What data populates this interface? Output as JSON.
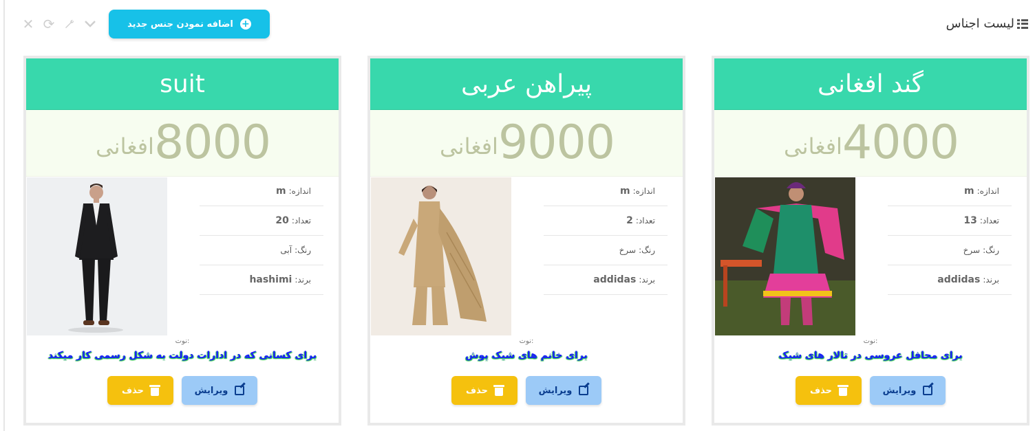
{
  "header": {
    "title": "لیست اجناس",
    "add_button_label": "اضافه نمودن جنس جدید"
  },
  "toolbar_icons": [
    "close-icon",
    "refresh-icon",
    "wrench-icon",
    "chevron-down-icon"
  ],
  "labels": {
    "size": "اندازه:",
    "count": "تعداد:",
    "color": "رنگ:",
    "brand": "برند:",
    "note": "نوت:",
    "currency": "افغانی",
    "edit": "ویرایش",
    "delete": "حذف"
  },
  "products": [
    {
      "name": "suit",
      "price": "8000",
      "size": "m",
      "count": "20",
      "color": "آبی",
      "brand": "hashimi",
      "note": "برای کسانی که در ادارات دولت به شکل رسمی کار میکند"
    },
    {
      "name": "پیراهن عربی",
      "price": "9000",
      "size": "m",
      "count": "2",
      "color": "سرخ",
      "brand": "addidas",
      "note": "برای خانم های شیک پوش"
    },
    {
      "name": "گند افغانی",
      "price": "4000",
      "size": "m",
      "count": "13",
      "color": "سرخ",
      "brand": "addidas",
      "note": "برای محافل عروسی در تالار های شیک"
    }
  ],
  "colors": {
    "card_header": "#38d8ac",
    "price_bg": "#f7fdf0",
    "add_button": "#17c1e8",
    "edit_button": "#9ccaf7",
    "delete_button": "#f5c10e"
  }
}
